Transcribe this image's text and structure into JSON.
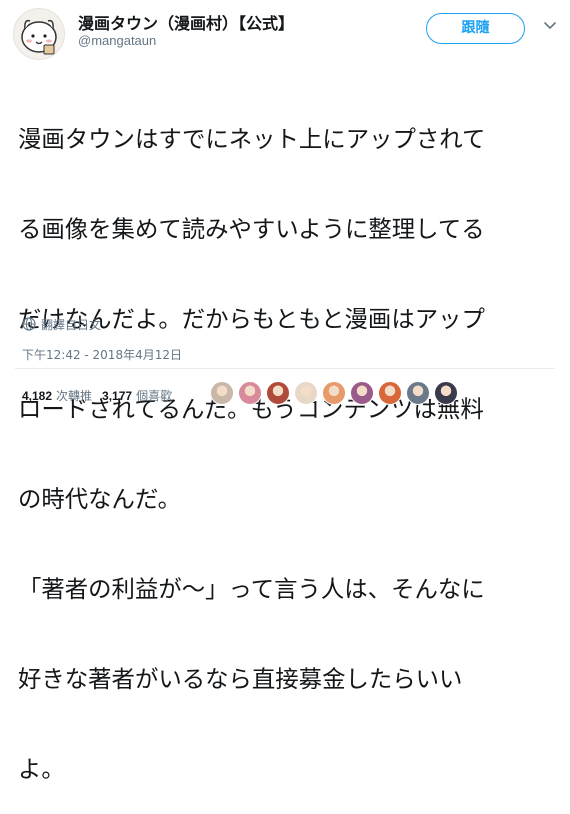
{
  "header": {
    "display_name": "漫画タウン（漫画村）【公式】",
    "handle": "@mangataun",
    "follow_label": "跟隨"
  },
  "tweet": {
    "lines": [
      "漫画タウンはすでにネット上にアップされて",
      "る画像を集めて読みやすいように整理してる",
      "だけなんだよ。だからもともと漫画はアップ",
      "ロードされてるんだ。もうコンテンツは無料",
      "の時代なんだ。",
      "「著者の利益が〜」って言う人は、そんなに",
      "好きな著者がいるなら直接募金したらいい",
      "よ。"
    ]
  },
  "translate_label": "翻譯自日文",
  "timestamp": "下午12:42 - 2018年4月12日",
  "stats": {
    "retweets_count": "4,182",
    "retweets_label": "次轉推",
    "likes_count": "3,177",
    "likes_label": "個喜歡"
  },
  "likers": {
    "count_shown": 9,
    "colors": [
      "#c9b8a8",
      "#d98a9a",
      "#b04a3a",
      "#e8d8c8",
      "#e89a6a",
      "#9a5a8a",
      "#d8683a",
      "#6a7a8a",
      "#3a3a4a"
    ]
  },
  "colors": {
    "accent": "#1da1f2",
    "muted": "#657786",
    "text": "#14171a"
  }
}
